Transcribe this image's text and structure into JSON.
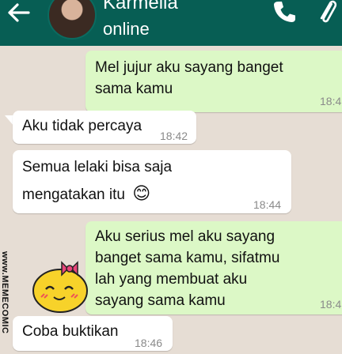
{
  "header": {
    "contact_name": "Karmella",
    "status": "online",
    "icons": [
      "back-arrow-icon",
      "avatar",
      "phone-icon",
      "paperclip-icon"
    ],
    "color": "#075e54"
  },
  "messages": [
    {
      "direction": "out",
      "text_lines": [
        "Mel jujur aku sayang banget",
        "sama kamu"
      ],
      "time": "18:4"
    },
    {
      "direction": "in",
      "text_lines": [
        "Aku tidak percaya"
      ],
      "time": "18:42"
    },
    {
      "direction": "in",
      "text_lines": [
        "Semua lelaki bisa saja",
        "mengatakan itu"
      ],
      "emoji": "😊",
      "time": "18:44"
    },
    {
      "direction": "out",
      "text_lines": [
        "Aku serius mel aku sayang",
        "banget sama kamu, sifatmu",
        "lah yang membuat aku",
        "sayang sama kamu"
      ],
      "time": "18:4"
    },
    {
      "direction": "in",
      "text_lines": [
        "Coba buktikan"
      ],
      "time": "18:46"
    }
  ],
  "watermark": "www.MEMECOMIC",
  "colors": {
    "outgoing": "#dcf8c6",
    "incoming": "#ffffff",
    "chat_bg": "#e6ddd4"
  }
}
